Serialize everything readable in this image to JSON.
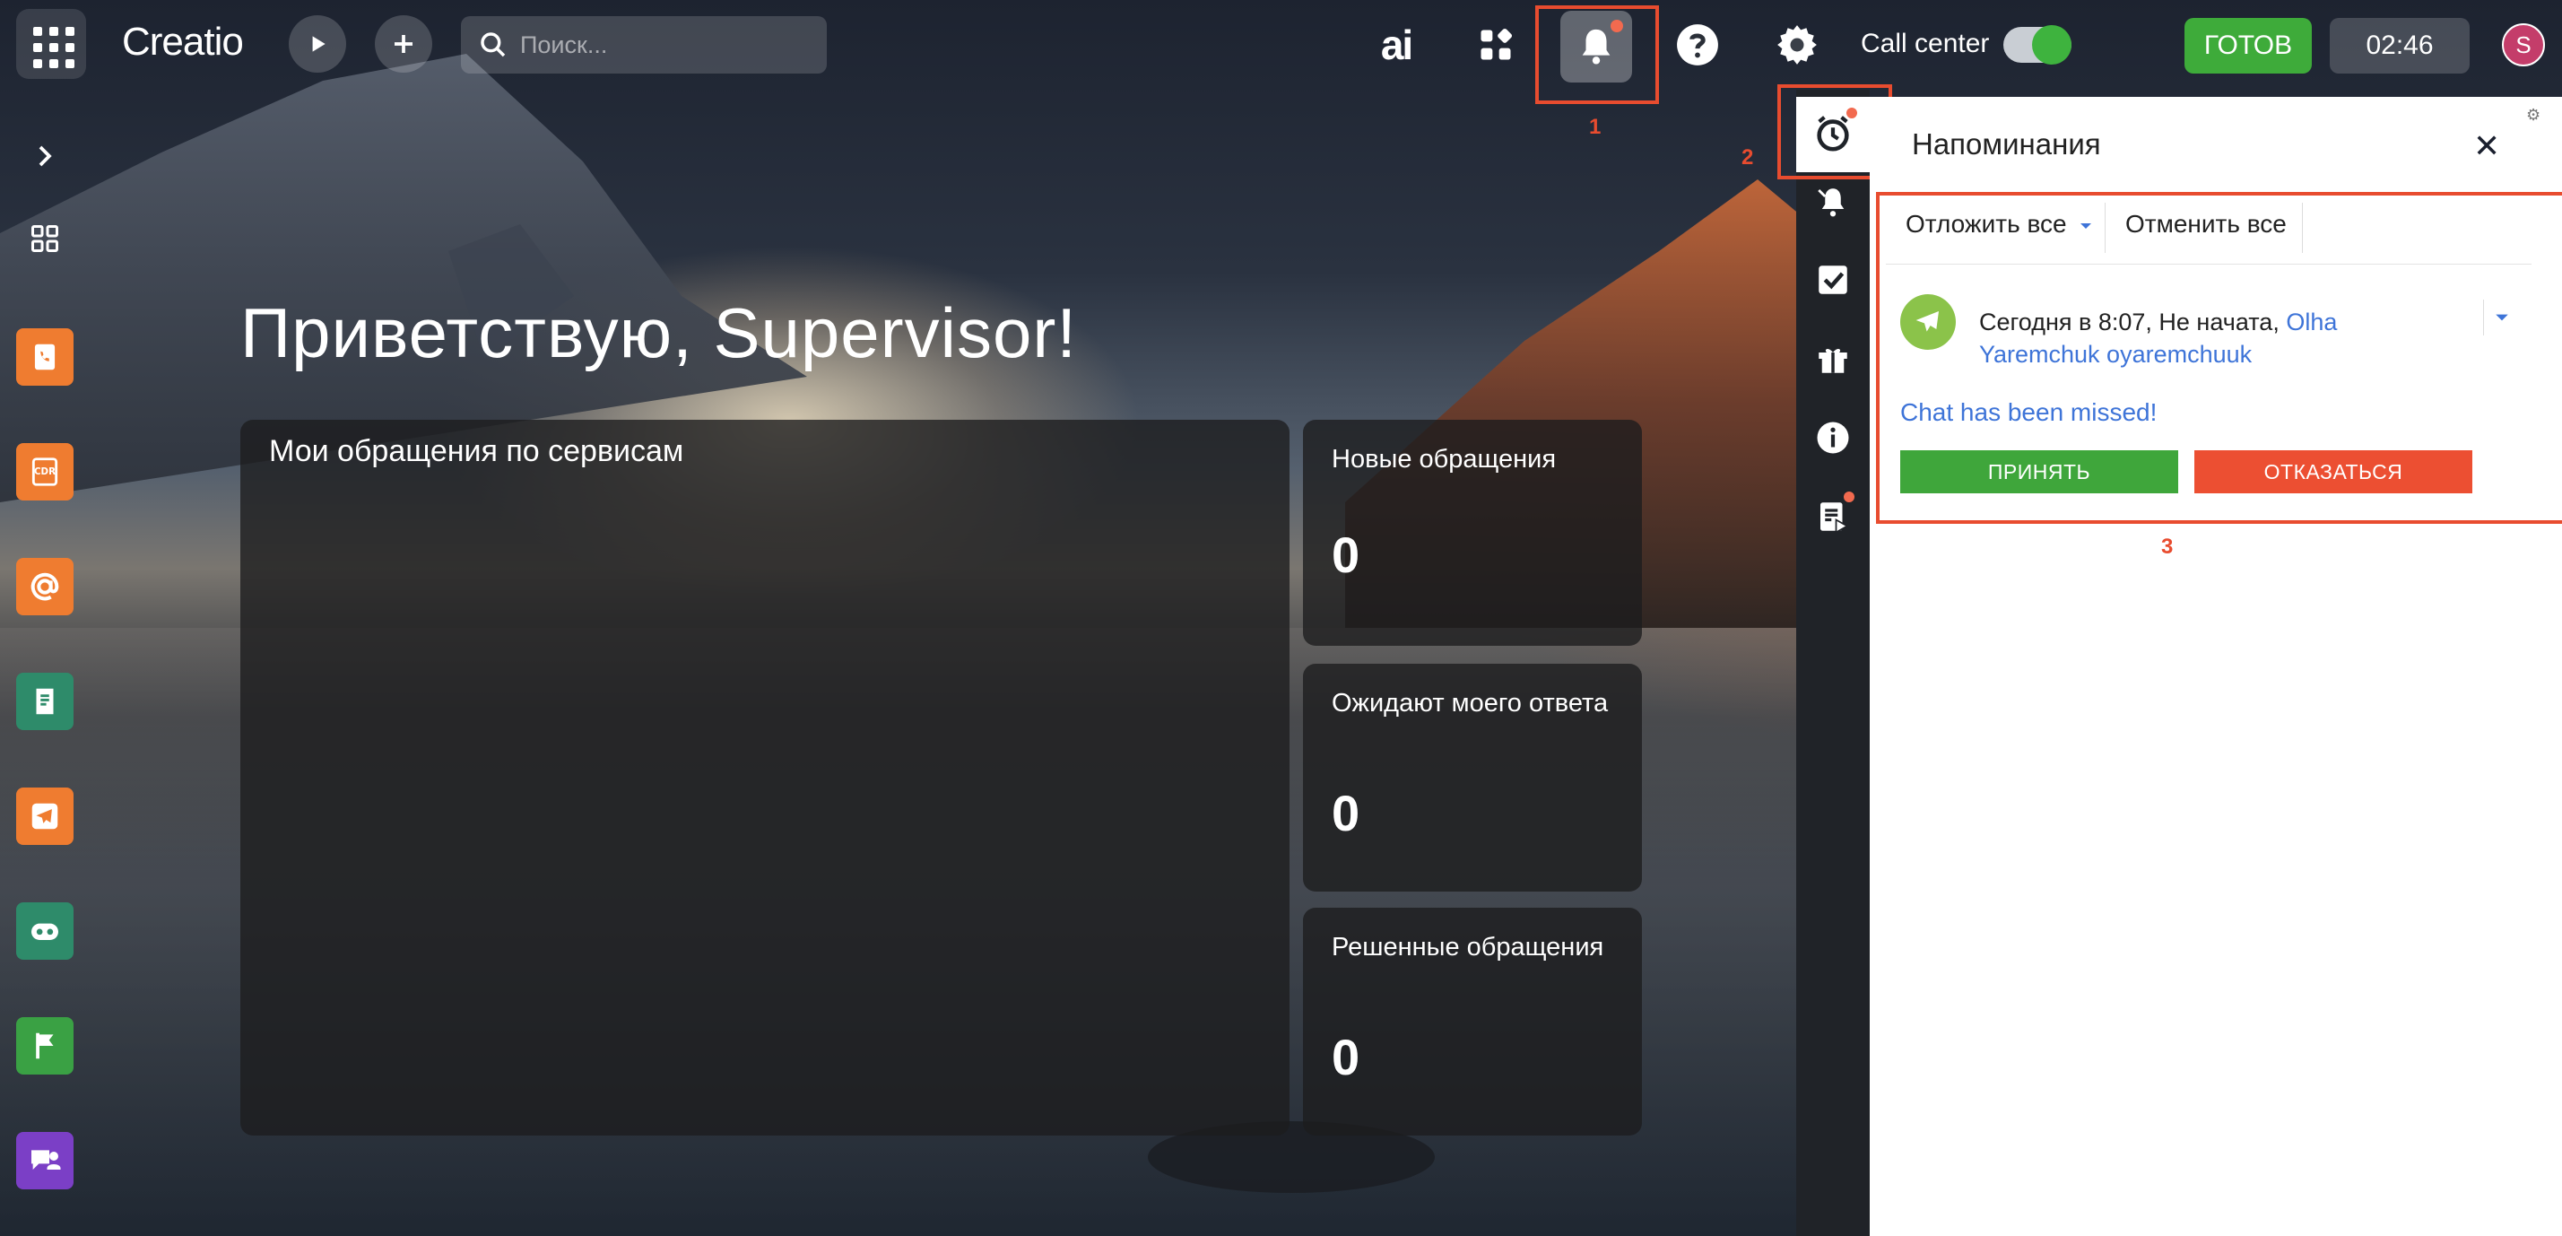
{
  "app": {
    "logo": "Creatio"
  },
  "topbar": {
    "search_placeholder": "Поиск...",
    "ai_label": "ai",
    "callcenter_label": "Call center",
    "callcenter_on": true,
    "status_label": "ГОТОВ",
    "timer": "02:46",
    "avatar_letter": "S"
  },
  "annotations": {
    "a1": "1",
    "a2": "2",
    "a3": "3"
  },
  "sidebar": {
    "items": [
      {
        "icon": "chevron-right-icon"
      },
      {
        "icon": "grid-icon"
      },
      {
        "icon": "phone-card-icon",
        "color": "#ef7c30"
      },
      {
        "icon": "cdr-icon",
        "color": "#ef7c30"
      },
      {
        "icon": "email-at-icon",
        "color": "#ef7c30"
      },
      {
        "icon": "document-icon",
        "color": "#2e8b6a"
      },
      {
        "icon": "telegram-icon",
        "color": "#ef7c30"
      },
      {
        "icon": "bot-icon",
        "color": "#2e8b6a"
      },
      {
        "icon": "flag-icon",
        "color": "#3aa144"
      },
      {
        "icon": "chat-person-icon",
        "color": "#7b3fc6"
      }
    ]
  },
  "main": {
    "greeting": "Приветствую, Supervisor!",
    "services_title": "Мои обращения по сервисам",
    "metrics": [
      {
        "title": "Новые обращения",
        "value": "0"
      },
      {
        "title": "Ожидают моего ответа",
        "value": "0"
      },
      {
        "title": "Решенные обращения",
        "value": "0"
      }
    ]
  },
  "reminders": {
    "title": "Напоминания",
    "postpone_all": "Отложить все",
    "cancel_all": "Отменить все",
    "item": {
      "when": "Сегодня в 8:07,",
      "status": "Не начата,",
      "owner_part1": "Olha",
      "owner_part2": "Yaremchuk oyaremchuuk",
      "message": "Chat has been missed!",
      "accept": "ПРИНЯТЬ",
      "decline": "ОТКАЗАТЬСЯ"
    }
  },
  "colors": {
    "accent_red": "#e84c2f",
    "ready_green": "#3eab3a",
    "accept_green": "#3fa63b",
    "decline_red": "#ec4f32",
    "link_blue": "#3e74d8"
  }
}
